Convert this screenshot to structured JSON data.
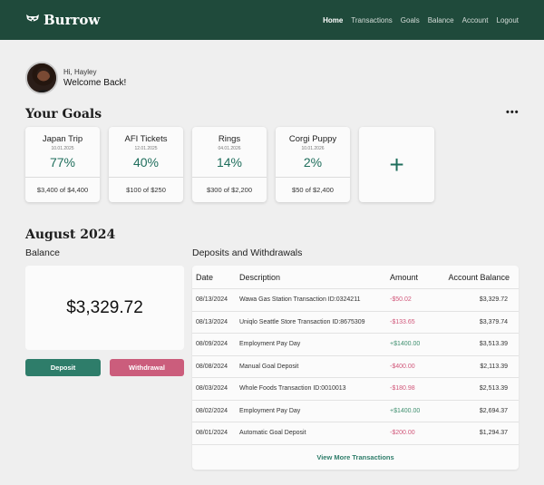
{
  "brand": {
    "name": "Burrow",
    "logo_icon": "raccoon-icon"
  },
  "nav": {
    "links": [
      "Home",
      "Transactions",
      "Goals",
      "Balance",
      "Account",
      "Logout"
    ],
    "active": "Home"
  },
  "greeting": {
    "hi": "Hi, Hayley",
    "welcome": "Welcome Back!"
  },
  "goals_section": {
    "title": "Your Goals",
    "more": "•••",
    "goals": [
      {
        "name": "Japan Trip",
        "date": "10.01.2025",
        "percent": "77%",
        "amount": "$3,400 of $4,400",
        "progress": 0.77
      },
      {
        "name": "AFI Tickets",
        "date": "12.01.2025",
        "percent": "40%",
        "amount": "$100 of $250",
        "progress": 0.4
      },
      {
        "name": "Rings",
        "date": "04.01.2026",
        "percent": "14%",
        "amount": "$300 of $2,200",
        "progress": 0.14
      },
      {
        "name": "Corgi Puppy",
        "date": "10.01.2026",
        "percent": "2%",
        "amount": "$50 of $2,400",
        "progress": 0.02
      }
    ],
    "add_symbol": "+"
  },
  "month": {
    "title": "August 2024"
  },
  "balance": {
    "label": "Balance",
    "amount": "$3,329.72",
    "deposit_label": "Deposit",
    "withdrawal_label": "Withdrawal"
  },
  "transactions": {
    "label": "Deposits and Withdrawals",
    "headers": {
      "date": "Date",
      "description": "Description",
      "amount": "Amount",
      "account_balance": "Account Balance"
    },
    "rows": [
      {
        "date": "08/13/2024",
        "description": "Wawa Gas Station Transaction ID:0324211",
        "amount": "-$50.02",
        "balance": "$3,329.72",
        "type": "neg"
      },
      {
        "date": "08/13/2024",
        "description": "Uniqlo Seattle Store Transaction ID:8675309",
        "amount": "-$133.65",
        "balance": "$3,379.74",
        "type": "neg"
      },
      {
        "date": "08/09/2024",
        "description": "Employment Pay Day",
        "amount": "+$1400.00",
        "balance": "$3,513.39",
        "type": "pos"
      },
      {
        "date": "08/08/2024",
        "description": "Manual Goal Deposit",
        "amount": "-$400.00",
        "balance": "$2,113.39",
        "type": "neg"
      },
      {
        "date": "08/03/2024",
        "description": "Whole Foods Transaction ID:0010013",
        "amount": "-$180.98",
        "balance": "$2,513.39",
        "type": "neg"
      },
      {
        "date": "08/02/2024",
        "description": "Employment Pay Day",
        "amount": "+$1400.00",
        "balance": "$2,694.37",
        "type": "pos"
      },
      {
        "date": "08/01/2024",
        "description": "Automatic Goal Deposit",
        "amount": "-$200.00",
        "balance": "$1,294.37",
        "type": "neg"
      }
    ],
    "view_more": "View More Transactions"
  },
  "colors": {
    "nav_bg": "#1f4a3b",
    "accent_green": "#2e7d6a",
    "accent_pink": "#cb5d7c",
    "goal_pct": "#1f6e5c"
  }
}
